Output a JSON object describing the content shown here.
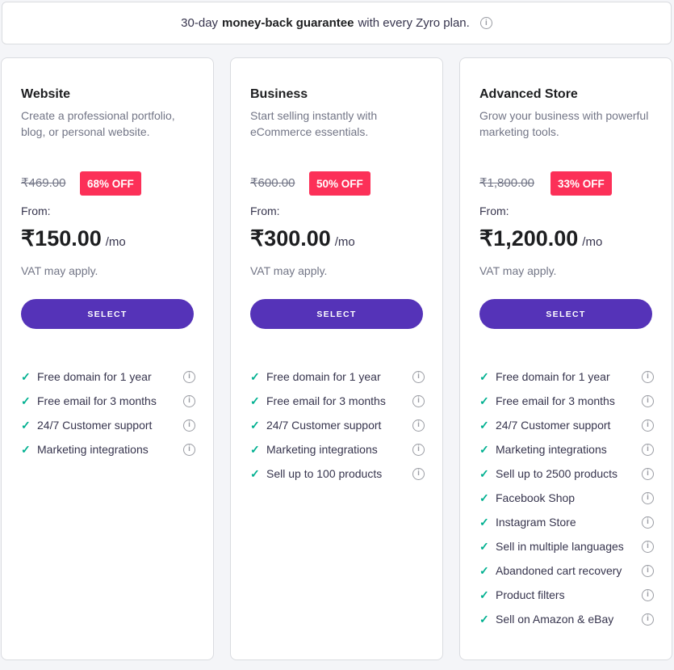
{
  "banner": {
    "prefix": "30-day",
    "bold": "money-back guarantee",
    "suffix": "with every Zyro plan.",
    "info_icon": "info-icon"
  },
  "select_label": "SELECT",
  "from_label": "From:",
  "per_label": "/mo",
  "vat_label": "VAT may apply.",
  "colors": {
    "accent": "#5533b8",
    "discount_badge": "#fc3058",
    "check": "#00b090",
    "background": "#f4f5f8"
  },
  "plans": [
    {
      "name": "Website",
      "desc": "Create a professional portfolio, blog, or personal website.",
      "old_price": "₹469.00",
      "discount": "68% OFF",
      "price": "₹150.00",
      "features": [
        "Free domain for 1 year",
        "Free email for 3 months",
        "24/7 Customer support",
        "Marketing integrations"
      ]
    },
    {
      "name": "Business",
      "desc": "Start selling instantly with eCommerce essentials.",
      "old_price": "₹600.00",
      "discount": "50% OFF",
      "price": "₹300.00",
      "features": [
        "Free domain for 1 year",
        "Free email for 3 months",
        "24/7 Customer support",
        "Marketing integrations",
        "Sell up to 100 products"
      ]
    },
    {
      "name": "Advanced Store",
      "desc": "Grow your business with powerful marketing tools.",
      "old_price": "₹1,800.00",
      "discount": "33% OFF",
      "price": "₹1,200.00",
      "features": [
        "Free domain for 1 year",
        "Free email for 3 months",
        "24/7 Customer support",
        "Marketing integrations",
        "Sell up to 2500 products",
        "Facebook Shop",
        "Instagram Store",
        "Sell in multiple languages",
        "Abandoned cart recovery",
        "Product filters",
        "Sell on Amazon & eBay"
      ]
    }
  ]
}
